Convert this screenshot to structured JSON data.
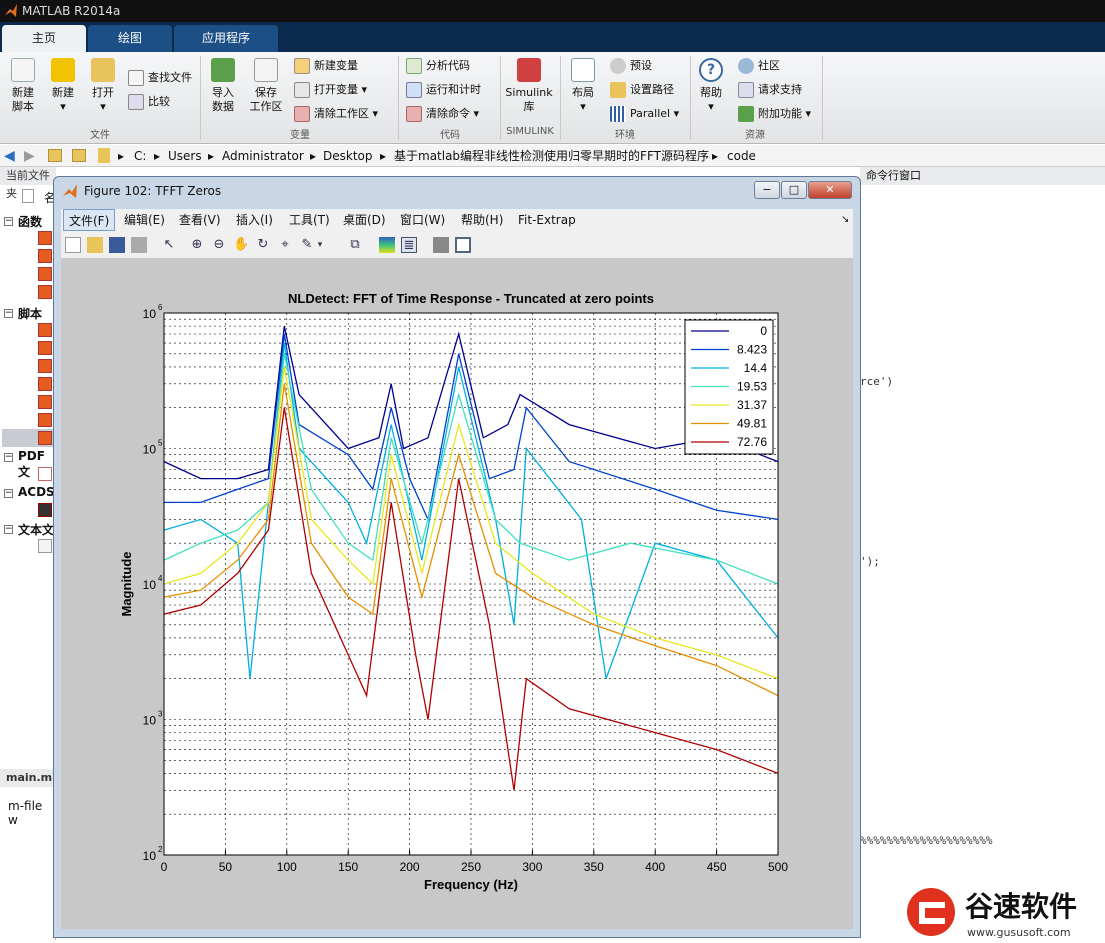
{
  "app": {
    "title": "MATLAB R2014a"
  },
  "tabs": [
    {
      "label": "主页"
    },
    {
      "label": "绘图"
    },
    {
      "label": "应用程序"
    }
  ],
  "ribbon": {
    "new_script": "新建\n脚本",
    "new": "新建",
    "open": "打开",
    "find_files": "查找文件",
    "compare": "比较",
    "import_data": "导入\n数据",
    "save_workspace": "保存\n工作区",
    "new_variable": "新建变量",
    "open_variable": "打开变量",
    "clear_workspace": "清除工作区",
    "analyze_code": "分析代码",
    "run_and_time": "运行和计时",
    "clear_commands": "清除命令",
    "simulink_library": "Simulink\n库",
    "layout": "布局",
    "preferences": "预设",
    "set_path": "设置路径",
    "parallel": "Parallel",
    "help": "帮助",
    "community": "社区",
    "request_support": "请求支持",
    "add_ons": "附加功能",
    "groups": {
      "file": "文件",
      "variable": "变量",
      "code": "代码",
      "simulink": "SIMULINK",
      "environment": "环境",
      "resources": "资源"
    }
  },
  "address": {
    "parts": [
      "C:",
      "Users",
      "Administrator",
      "Desktop",
      "基于matlab编程非线性检测使用归零早期时的FFT源码程序",
      "code"
    ]
  },
  "left_panel": {
    "header": "当前文件夹",
    "col": "名",
    "groups": [
      "函数",
      "脚本",
      "PDF 文",
      "ACDS",
      "文本文"
    ],
    "editor_tab": "main.m",
    "editor_text": "m-file w"
  },
  "command_window": {
    "header": "命令行窗口",
    "lines": [
      {
        "t": "rce')"
      },
      {
        "t": "');"
      },
      {
        "t": "%%%%%%%%%%%%%%%%%%%%"
      }
    ]
  },
  "figure": {
    "title": "Figure 102: TFFT Zeros",
    "menu": [
      "文件(F)",
      "编辑(E)",
      "查看(V)",
      "插入(I)",
      "工具(T)",
      "桌面(D)",
      "窗口(W)",
      "帮助(H)",
      "Fit-Extrap"
    ]
  },
  "chart_data": {
    "type": "line",
    "title": "NLDetect: FFT of Time Response - Truncated at zero points",
    "xlabel": "Frequency (Hz)",
    "ylabel": "Magnitude",
    "xlim": [
      0,
      500
    ],
    "ylim": [
      100,
      1000000
    ],
    "yscale": "log",
    "grid": true,
    "xticks": [
      0,
      50,
      100,
      150,
      200,
      250,
      300,
      350,
      400,
      450,
      500
    ],
    "yticks": [
      {
        "base": "10",
        "exp": "2"
      },
      {
        "base": "10",
        "exp": "3"
      },
      {
        "base": "10",
        "exp": "4"
      },
      {
        "base": "10",
        "exp": "5"
      },
      {
        "base": "10",
        "exp": "6"
      }
    ],
    "legend": {
      "position": "top-right",
      "entries": [
        "0",
        "8.423",
        "14.4",
        "19.53",
        "31.37",
        "49.81",
        "72.76"
      ]
    },
    "colors": [
      "#00008f",
      "#0040d0",
      "#00b0e0",
      "#40e0c0",
      "#e8e820",
      "#e89000",
      "#b00000"
    ],
    "series": [
      {
        "name": "0",
        "points": [
          [
            0,
            80000
          ],
          [
            30,
            60000
          ],
          [
            60,
            60000
          ],
          [
            85,
            70000
          ],
          [
            98,
            800000
          ],
          [
            110,
            250000
          ],
          [
            150,
            100000
          ],
          [
            175,
            120000
          ],
          [
            185,
            300000
          ],
          [
            195,
            100000
          ],
          [
            215,
            120000
          ],
          [
            240,
            700000
          ],
          [
            260,
            120000
          ],
          [
            280,
            150000
          ],
          [
            290,
            250000
          ],
          [
            330,
            150000
          ],
          [
            400,
            100000
          ],
          [
            450,
            120000
          ],
          [
            500,
            80000
          ]
        ]
      },
      {
        "name": "8.423",
        "points": [
          [
            0,
            40000
          ],
          [
            30,
            40000
          ],
          [
            60,
            50000
          ],
          [
            85,
            60000
          ],
          [
            98,
            700000
          ],
          [
            110,
            150000
          ],
          [
            150,
            90000
          ],
          [
            170,
            50000
          ],
          [
            185,
            200000
          ],
          [
            200,
            60000
          ],
          [
            215,
            30000
          ],
          [
            240,
            500000
          ],
          [
            265,
            60000
          ],
          [
            285,
            70000
          ],
          [
            295,
            200000
          ],
          [
            330,
            80000
          ],
          [
            400,
            50000
          ],
          [
            450,
            35000
          ],
          [
            500,
            30000
          ]
        ]
      },
      {
        "name": "14.4",
        "points": [
          [
            0,
            25000
          ],
          [
            30,
            30000
          ],
          [
            60,
            20000
          ],
          [
            70,
            2000
          ],
          [
            85,
            40000
          ],
          [
            98,
            600000
          ],
          [
            110,
            100000
          ],
          [
            150,
            40000
          ],
          [
            165,
            20000
          ],
          [
            185,
            150000
          ],
          [
            210,
            15000
          ],
          [
            240,
            400000
          ],
          [
            270,
            30000
          ],
          [
            285,
            5000
          ],
          [
            295,
            100000
          ],
          [
            340,
            30000
          ],
          [
            360,
            2000
          ],
          [
            400,
            20000
          ],
          [
            450,
            15000
          ],
          [
            500,
            4000
          ]
        ]
      },
      {
        "name": "19.53",
        "points": [
          [
            0,
            15000
          ],
          [
            30,
            20000
          ],
          [
            60,
            25000
          ],
          [
            85,
            40000
          ],
          [
            98,
            500000
          ],
          [
            120,
            50000
          ],
          [
            150,
            20000
          ],
          [
            170,
            15000
          ],
          [
            185,
            120000
          ],
          [
            210,
            20000
          ],
          [
            240,
            250000
          ],
          [
            270,
            30000
          ],
          [
            290,
            20000
          ],
          [
            330,
            15000
          ],
          [
            380,
            20000
          ],
          [
            450,
            15000
          ],
          [
            500,
            10000
          ]
        ]
      },
      {
        "name": "31.37",
        "points": [
          [
            0,
            10000
          ],
          [
            30,
            12000
          ],
          [
            60,
            20000
          ],
          [
            85,
            40000
          ],
          [
            98,
            400000
          ],
          [
            120,
            30000
          ],
          [
            150,
            15000
          ],
          [
            170,
            10000
          ],
          [
            185,
            90000
          ],
          [
            210,
            12000
          ],
          [
            240,
            150000
          ],
          [
            270,
            20000
          ],
          [
            300,
            12000
          ],
          [
            350,
            6000
          ],
          [
            400,
            4000
          ],
          [
            450,
            3000
          ],
          [
            500,
            2000
          ]
        ]
      },
      {
        "name": "49.81",
        "points": [
          [
            0,
            8000
          ],
          [
            30,
            9000
          ],
          [
            60,
            15000
          ],
          [
            85,
            30000
          ],
          [
            98,
            300000
          ],
          [
            120,
            20000
          ],
          [
            150,
            8000
          ],
          [
            170,
            6000
          ],
          [
            185,
            60000
          ],
          [
            210,
            8000
          ],
          [
            240,
            90000
          ],
          [
            270,
            12000
          ],
          [
            300,
            8000
          ],
          [
            350,
            5000
          ],
          [
            400,
            3500
          ],
          [
            450,
            2500
          ],
          [
            500,
            1500
          ]
        ]
      },
      {
        "name": "72.76",
        "points": [
          [
            0,
            6000
          ],
          [
            30,
            7000
          ],
          [
            60,
            12000
          ],
          [
            85,
            25000
          ],
          [
            98,
            200000
          ],
          [
            120,
            12000
          ],
          [
            150,
            3000
          ],
          [
            165,
            1500
          ],
          [
            185,
            40000
          ],
          [
            205,
            3000
          ],
          [
            215,
            1000
          ],
          [
            240,
            60000
          ],
          [
            265,
            5000
          ],
          [
            285,
            300
          ],
          [
            295,
            2000
          ],
          [
            330,
            1200
          ],
          [
            400,
            800
          ],
          [
            450,
            600
          ],
          [
            500,
            400
          ]
        ]
      }
    ]
  }
}
